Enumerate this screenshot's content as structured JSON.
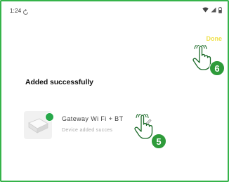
{
  "status_bar": {
    "time": "1:24",
    "sync_icon": "sync-icon",
    "right_icons": [
      "wifi-icon",
      "signal-icon",
      "battery-icon"
    ]
  },
  "header": {
    "done_label": "Done"
  },
  "page": {
    "title": "Added successfully"
  },
  "device": {
    "name": "Gateway Wi Fi + BT",
    "status": "Device added succes",
    "icons": [
      "gateway-device-icon",
      "success-check-icon",
      "edit-pencil-icon"
    ]
  },
  "annotations": [
    {
      "number": "6",
      "icon": "tap-hand-icon"
    },
    {
      "number": "5",
      "icon": "tap-hand-icon"
    }
  ],
  "colors": {
    "frame": "#35b34a",
    "done": "#f0e14a",
    "badge": "#2e9b3a",
    "check": "#27a84a"
  }
}
